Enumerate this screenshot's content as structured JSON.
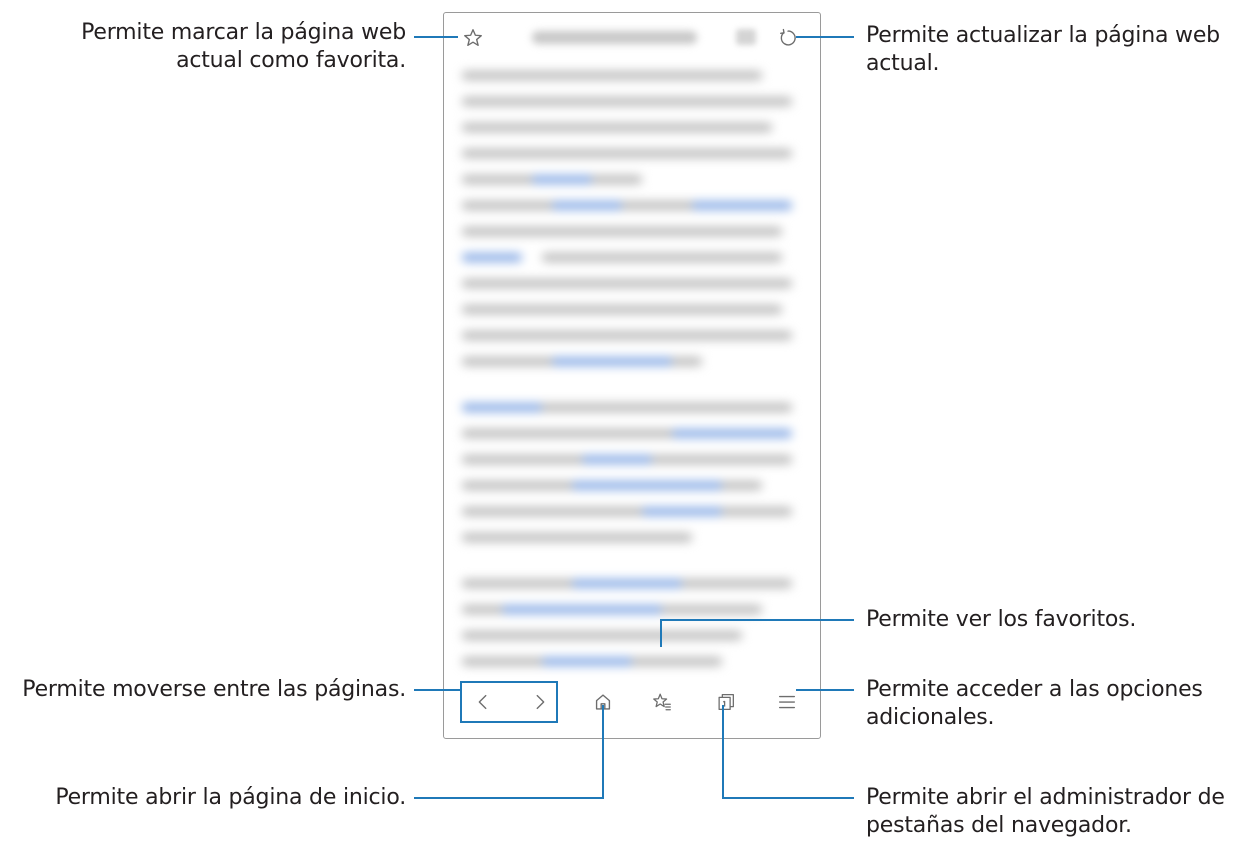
{
  "callouts": {
    "favorite": {
      "line1": "Permite marcar la página web",
      "line2": "actual como favorita."
    },
    "refresh": {
      "line1": "Permite actualizar la página web",
      "line2": "actual."
    },
    "bookmarks": {
      "text": "Permite ver los favoritos."
    },
    "navigate": {
      "text": "Permite moverse entre las páginas."
    },
    "more_options": {
      "line1": "Permite acceder a las opciones",
      "line2": "adicionales."
    },
    "home": {
      "text": "Permite abrir la página de inicio."
    },
    "tabs": {
      "line1": "Permite abrir el administrador de",
      "line2": "pestañas del navegador."
    }
  },
  "icons": {
    "favorite": "star-outline-icon",
    "refresh": "refresh-icon",
    "back": "chevron-left-icon",
    "forward": "chevron-right-icon",
    "home": "home-icon",
    "bookmarks": "bookmarks-star-list-icon",
    "tabs": "tabs-icon",
    "menu": "hamburger-menu-icon"
  },
  "colors": {
    "accent": "#1f79b8",
    "text": "#231f20",
    "icon": "#6d6d6d",
    "frame": "#9a9a9a"
  }
}
